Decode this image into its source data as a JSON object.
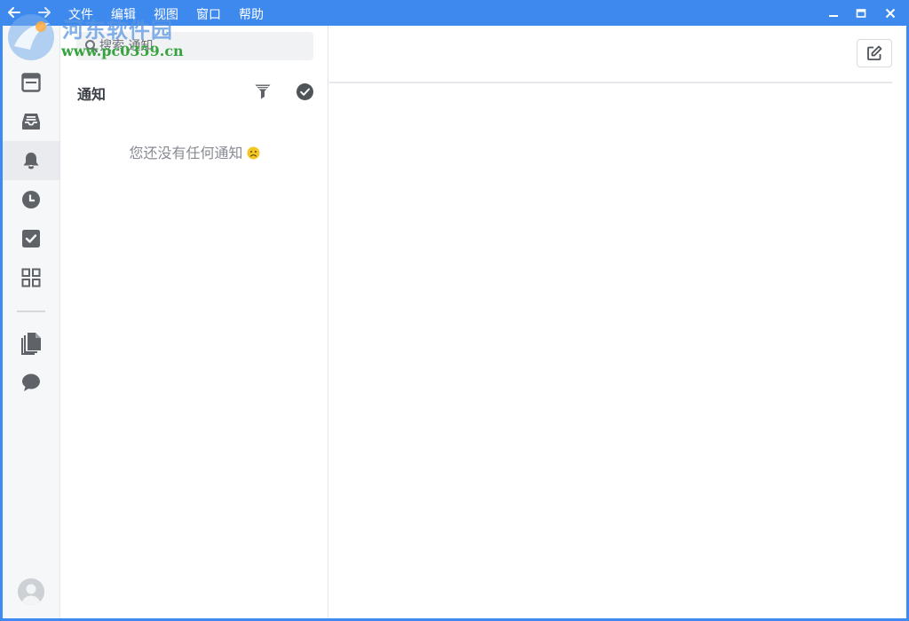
{
  "titlebar": {
    "menu": [
      "文件",
      "编辑",
      "视图",
      "窗口",
      "帮助"
    ],
    "back_icon": "arrow-left-icon",
    "forward_icon": "arrow-right-icon",
    "controls": [
      "minimize-icon",
      "maximize-icon",
      "close-icon"
    ]
  },
  "watermark": {
    "site": "河东软件园",
    "url": "www.pc0359.cn"
  },
  "rail": {
    "items": [
      {
        "icon": "browser-window-icon",
        "active": false
      },
      {
        "icon": "inbox-tray-icon",
        "active": false
      },
      {
        "icon": "bell-icon",
        "active": true
      },
      {
        "icon": "clock-icon",
        "active": false
      },
      {
        "icon": "checkbox-icon",
        "active": false
      },
      {
        "icon": "grid-apps-icon",
        "active": false
      },
      {
        "icon": "documents-icon",
        "active": false
      },
      {
        "icon": "chat-bubble-icon",
        "active": false
      }
    ],
    "avatar_icon": "user-avatar-icon"
  },
  "notifications": {
    "search_placeholder": "搜索 通知",
    "title": "通知",
    "filter_icon": "filter-funnel-icon",
    "mark_all_icon": "check-circle-icon",
    "empty_text": "您还没有任何通知",
    "empty_emoji_icon": "sad-face-icon"
  },
  "detail": {
    "compose_icon": "edit-compose-icon"
  },
  "colors": {
    "titlebar": "#3e89ee",
    "rail_bg": "#f6f7f8",
    "icon": "#5f6368",
    "active_bg": "#e9ebee",
    "emoji": "#f3c623"
  }
}
